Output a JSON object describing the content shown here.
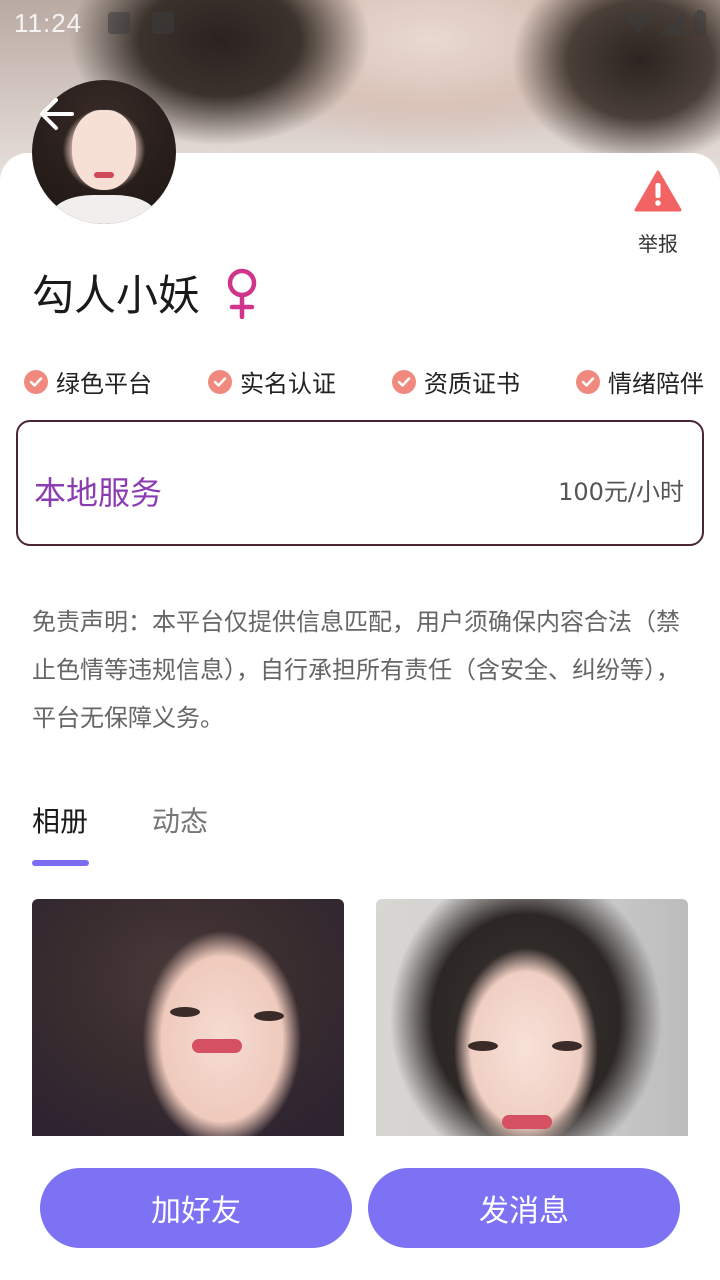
{
  "status_bar": {
    "time": "11:24"
  },
  "profile": {
    "name": "勾人小妖",
    "gender_symbol": "♀",
    "report_label": "举报"
  },
  "tags": [
    {
      "label": "绿色平台"
    },
    {
      "label": "实名认证"
    },
    {
      "label": "资质证书"
    },
    {
      "label": "情绪陪伴"
    }
  ],
  "service": {
    "title": "本地服务",
    "price": "100元/小时"
  },
  "disclaimer": "免责声明：本平台仅提供信息匹配，用户须确保内容合法（禁止色情等违规信息），自行承担所有责任（含安全、纠纷等），平台无保障义务。",
  "tabs": [
    {
      "label": "相册",
      "active": true
    },
    {
      "label": "动态",
      "active": false
    }
  ],
  "actions": {
    "add_friend": "加好友",
    "send_message": "发消息"
  },
  "colors": {
    "accent": "#7D72F3",
    "service_title": "#8A3CB0",
    "check": "#F08A7E",
    "report": "#F26464",
    "gender": "#D0358C"
  }
}
